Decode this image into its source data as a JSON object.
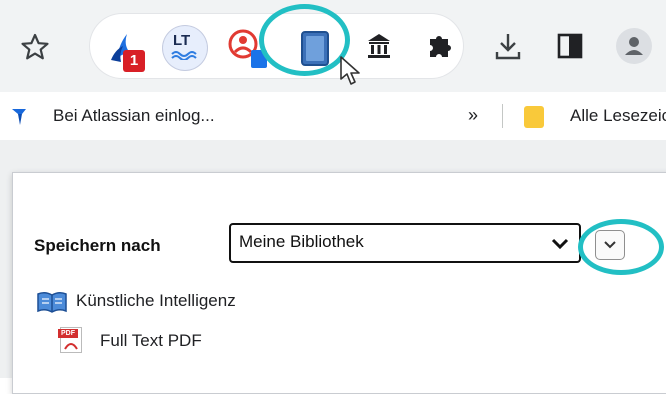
{
  "toolbar": {
    "icons": [
      "star-icon",
      "confluence-notification-icon",
      "languagetool-icon",
      "profile-extension-icon",
      "book-icon",
      "library-icon",
      "puzzle-icon",
      "download-icon",
      "sidebar-icon",
      "account-icon"
    ],
    "notification_badge": "1",
    "languagetool_label": "LT",
    "accent_color": "#22bfc4"
  },
  "bookmarks": {
    "item1_label": "Bei Atlassian einlog...",
    "overflow_label": "»",
    "item2_label": "Alle Lesezeichen"
  },
  "popup": {
    "save_label": "Speichern nach",
    "library_value": "Meine Bibliothek",
    "item_title": "Künstliche Intelligenz",
    "attachment_label": "Full Text PDF",
    "pdf_badge": "PDF"
  }
}
